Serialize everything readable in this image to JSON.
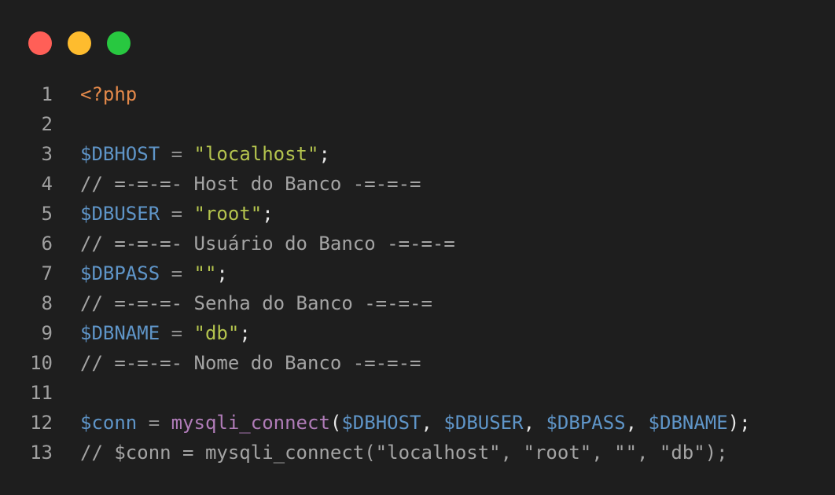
{
  "window": {
    "controls": [
      {
        "name": "close",
        "color": "#ff5f57"
      },
      {
        "name": "minimize",
        "color": "#febc2e"
      },
      {
        "name": "maximize",
        "color": "#28c840"
      }
    ]
  },
  "code": {
    "lines": [
      {
        "number": "1",
        "tokens": [
          {
            "type": "tag",
            "text": "<?php"
          }
        ]
      },
      {
        "number": "2",
        "tokens": []
      },
      {
        "number": "3",
        "tokens": [
          {
            "type": "var",
            "text": "$DBHOST"
          },
          {
            "type": "op",
            "text": " = "
          },
          {
            "type": "str",
            "text": "\"localhost\""
          },
          {
            "type": "punc",
            "text": ";"
          }
        ]
      },
      {
        "number": "4",
        "tokens": [
          {
            "type": "comment",
            "text": "// =-=-=- Host do Banco -=-=-="
          }
        ]
      },
      {
        "number": "5",
        "tokens": [
          {
            "type": "var",
            "text": "$DBUSER"
          },
          {
            "type": "op",
            "text": " = "
          },
          {
            "type": "str",
            "text": "\"root\""
          },
          {
            "type": "punc",
            "text": ";"
          }
        ]
      },
      {
        "number": "6",
        "tokens": [
          {
            "type": "comment",
            "text": "// =-=-=- Usuário do Banco -=-=-="
          }
        ]
      },
      {
        "number": "7",
        "tokens": [
          {
            "type": "var",
            "text": "$DBPASS"
          },
          {
            "type": "op",
            "text": " = "
          },
          {
            "type": "str",
            "text": "\"\""
          },
          {
            "type": "punc",
            "text": ";"
          }
        ]
      },
      {
        "number": "8",
        "tokens": [
          {
            "type": "comment",
            "text": "// =-=-=- Senha do Banco -=-=-="
          }
        ]
      },
      {
        "number": "9",
        "tokens": [
          {
            "type": "var",
            "text": "$DBNAME"
          },
          {
            "type": "op",
            "text": " = "
          },
          {
            "type": "str",
            "text": "\"db\""
          },
          {
            "type": "punc",
            "text": ";"
          }
        ]
      },
      {
        "number": "10",
        "tokens": [
          {
            "type": "comment",
            "text": "// =-=-=- Nome do Banco -=-=-="
          }
        ]
      },
      {
        "number": "11",
        "tokens": []
      },
      {
        "number": "12",
        "tokens": [
          {
            "type": "var",
            "text": "$conn"
          },
          {
            "type": "op",
            "text": " = "
          },
          {
            "type": "func",
            "text": "mysqli_connect"
          },
          {
            "type": "punc",
            "text": "("
          },
          {
            "type": "var",
            "text": "$DBHOST"
          },
          {
            "type": "punc",
            "text": ", "
          },
          {
            "type": "var",
            "text": "$DBUSER"
          },
          {
            "type": "punc",
            "text": ", "
          },
          {
            "type": "var",
            "text": "$DBPASS"
          },
          {
            "type": "punc",
            "text": ", "
          },
          {
            "type": "var",
            "text": "$DBNAME"
          },
          {
            "type": "punc",
            "text": ");"
          }
        ]
      },
      {
        "number": "13",
        "tokens": [
          {
            "type": "comment",
            "text": "// $conn = mysqli_connect(\"localhost\", \"root\", \"\", \"db\");"
          }
        ]
      }
    ]
  }
}
